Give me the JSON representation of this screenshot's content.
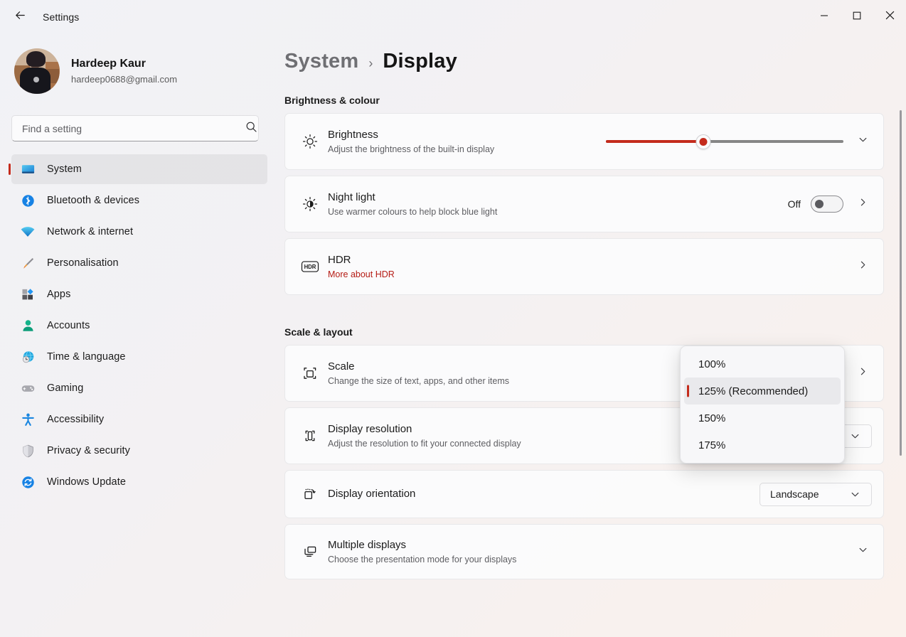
{
  "window": {
    "title": "Settings",
    "back_icon": "back-arrow-icon",
    "minimize_label": "Minimise",
    "maximize_label": "Maximise",
    "close_label": "Close"
  },
  "sidebar": {
    "profile": {
      "name": "Hardeep Kaur",
      "email": "hardeep0688@gmail.com",
      "avatar_icon": "user-avatar-photo"
    },
    "search": {
      "placeholder": "Find a setting",
      "value": "",
      "icon": "search-icon"
    },
    "items": [
      {
        "label": "System",
        "icon": "monitor-icon",
        "active": true
      },
      {
        "label": "Bluetooth & devices",
        "icon": "bluetooth-icon",
        "active": false
      },
      {
        "label": "Network & internet",
        "icon": "wifi-icon",
        "active": false
      },
      {
        "label": "Personalisation",
        "icon": "paintbrush-icon",
        "active": false
      },
      {
        "label": "Apps",
        "icon": "apps-grid-icon",
        "active": false
      },
      {
        "label": "Accounts",
        "icon": "person-icon",
        "active": false
      },
      {
        "label": "Time & language",
        "icon": "globe-clock-icon",
        "active": false
      },
      {
        "label": "Gaming",
        "icon": "gamepad-icon",
        "active": false
      },
      {
        "label": "Accessibility",
        "icon": "accessibility-person-icon",
        "active": false
      },
      {
        "label": "Privacy & security",
        "icon": "shield-icon",
        "active": false
      },
      {
        "label": "Windows Update",
        "icon": "refresh-circle-icon",
        "active": false
      }
    ]
  },
  "breadcrumb": {
    "parent": "System",
    "separator": "›",
    "current": "Display"
  },
  "sections": [
    {
      "title": "Brightness & colour"
    },
    {
      "title": "Scale & layout"
    }
  ],
  "brightness_card": {
    "icon": "brightness-sun-icon",
    "title": "Brightness",
    "subtitle": "Adjust the brightness of the built-in display",
    "slider": {
      "value": 41,
      "min": 0,
      "max": 100,
      "fill_color": "#c42b1c",
      "track_color": "#868686"
    },
    "expand_icon": "chevron-down-icon"
  },
  "nightlight_card": {
    "icon": "night-light-icon",
    "title": "Night light",
    "subtitle": "Use warmer colours to help block blue light",
    "toggle_state": "Off",
    "toggle_on": false,
    "chevron_icon": "chevron-right-icon"
  },
  "hdr_card": {
    "icon": "hdr-badge-icon",
    "title": "HDR",
    "link_text": "More about HDR",
    "link_color": "#b51b14",
    "chevron_icon": "chevron-right-icon"
  },
  "scale_card": {
    "icon": "scale-square-icon",
    "title": "Scale",
    "subtitle": "Change the size of text, apps, and other items",
    "chevron_icon": "chevron-right-icon"
  },
  "resolution_card": {
    "icon": "display-resolution-icon",
    "title": "Display resolution",
    "subtitle": "Adjust the resolution to fit your connected display",
    "chevron_icon": "chevron-down-icon"
  },
  "orientation_card": {
    "icon": "display-orientation-icon",
    "title": "Display orientation",
    "value": "Landscape",
    "chevron_icon": "chevron-down-icon"
  },
  "multiple_displays_card": {
    "icon": "multiple-displays-icon",
    "title": "Multiple displays",
    "subtitle": "Choose the presentation mode for your displays",
    "expand_icon": "chevron-down-icon"
  },
  "scale_dropdown": {
    "open": true,
    "selected": "125% (Recommended)",
    "options": [
      {
        "label": "100%",
        "selected": false
      },
      {
        "label": "125% (Recommended)",
        "selected": true
      },
      {
        "label": "150%",
        "selected": false
      },
      {
        "label": "175%",
        "selected": false
      }
    ]
  },
  "colors": {
    "accent": "#c42b1c",
    "link": "#b51b14",
    "text_primary": "#1b1b1b",
    "text_secondary": "#5e5e62"
  }
}
